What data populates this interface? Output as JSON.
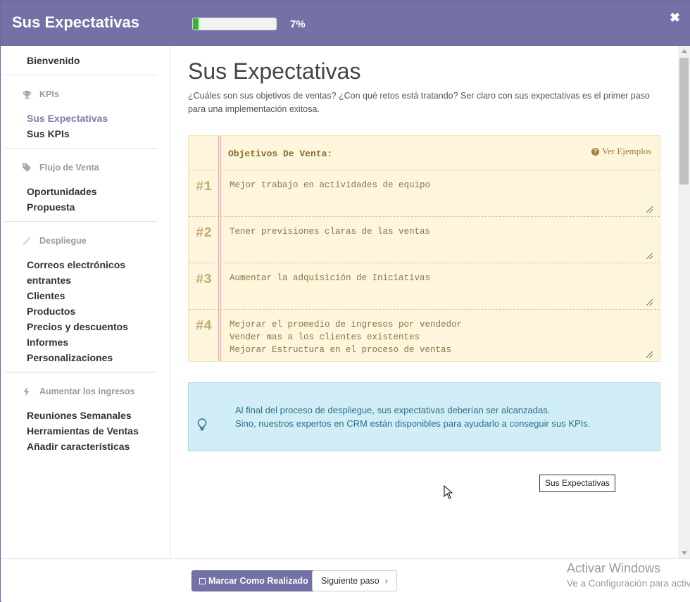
{
  "header": {
    "title": "Sus Expectativas",
    "progress_percent": 7,
    "progress_label": "7%",
    "close_icon": "close-icon",
    "accent_color": "#7371a6",
    "progress_color": "#2eb82e"
  },
  "sidebar": {
    "welcome": "Bienvenido",
    "groups": [
      {
        "label": "KPIs",
        "icon": "trophy-icon",
        "items": [
          "Sus Expectativas",
          "Sus KPIs"
        ]
      },
      {
        "label": "Flujo de Venta",
        "icon": "tag-icon",
        "items": [
          "Oportunidades",
          "Propuesta"
        ]
      },
      {
        "label": "Despliegue",
        "icon": "magic-wand-icon",
        "items": [
          "Correos electrónicos",
          "entrantes",
          "Clientes",
          "Productos",
          "Precios y descuentos",
          "Informes",
          "Personalizaciones"
        ]
      },
      {
        "label": "Aumentar los ingresos",
        "icon": "bolt-icon",
        "items": [
          "Reuniones Semanales",
          "Herramientas de Ventas",
          "Añadir características"
        ]
      }
    ],
    "active_item": "Sus Expectativas",
    "active_color": "#7c7bad"
  },
  "main": {
    "title": "Sus Expectativas",
    "intro": "¿Cuáles son sus objetivos de ventas? ¿Con qué retos está tratando? Ser claro con sus expectativas es el primer paso para una implementación exitosa.",
    "notebook": {
      "heading": "Objetivos De Venta:",
      "examples_label": "Ver Ejemplos",
      "rows": [
        {
          "num": "#1",
          "text": "Mejor trabajo en actividades de equipo"
        },
        {
          "num": "#2",
          "text": "Tener previsiones claras de las ventas"
        },
        {
          "num": "#3",
          "text": "Aumentar la adquisición de Iniciativas"
        },
        {
          "num": "#4",
          "text": "Mejorar el promedio de ingresos por vendedor\nVender mas a los clientes existentes\nMejorar Estructura en el proceso de ventas"
        }
      ]
    },
    "alert": {
      "icon": "lightbulb-icon",
      "line1": "Al final del proceso de despliegue, sus expectativas deberían ser alcanzadas.",
      "line2": "Sino, nuestros expertos en CRM están disponibles para ayudarlo a conseguir sus KPIs."
    },
    "tooltip": "Sus Expectativas"
  },
  "footer": {
    "mark_done": "Marcar Como Realizado",
    "next_step": "Siguiente paso",
    "watermark_title": "Activar Windows",
    "watermark_sub": "Ve a Configuración para activar Windows."
  }
}
